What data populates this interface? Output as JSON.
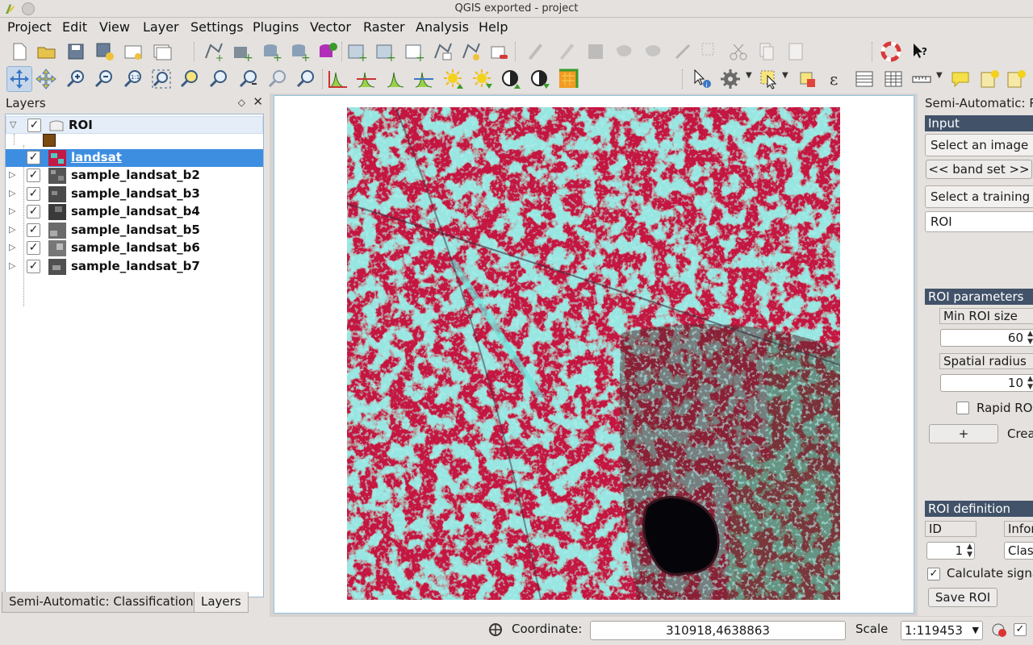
{
  "window": {
    "title": "QGIS exported - project"
  },
  "menu": [
    "Project",
    "Edit",
    "View",
    "Layer",
    "Settings",
    "Plugins",
    "Vector",
    "Raster",
    "Analysis",
    "Help"
  ],
  "layers_panel": {
    "title": "Layers",
    "float_icon": "◇",
    "close_icon": "✕",
    "group": {
      "name": "ROI",
      "checked": "✓",
      "expander": "▽"
    },
    "layers": [
      {
        "name": "landsat",
        "checked": "✓",
        "selected": true
      },
      {
        "name": "sample_landsat_b2",
        "checked": "✓",
        "expander": "▷"
      },
      {
        "name": "sample_landsat_b3",
        "checked": "✓",
        "expander": "▷"
      },
      {
        "name": "sample_landsat_b4",
        "checked": "✓",
        "expander": "▷"
      },
      {
        "name": "sample_landsat_b5",
        "checked": "✓",
        "expander": "▷"
      },
      {
        "name": "sample_landsat_b6",
        "checked": "✓",
        "expander": "▷"
      },
      {
        "name": "sample_landsat_b7",
        "checked": "✓",
        "expander": "▷"
      }
    ]
  },
  "bottom_tabs": [
    "Semi-Automatic: Classification",
    "Layers"
  ],
  "scp_dock": {
    "title": "Semi-Automatic: R",
    "input_header": "Input",
    "select_image": "Select an image",
    "band_set_button": "<< band set >>",
    "select_training": "Select a training s",
    "training_value": "ROI",
    "roi_params_header": "ROI parameters",
    "min_roi_size_label": "Min ROI size",
    "min_roi_size_value": "60",
    "spatial_radius_label": "Spatial radius",
    "spatial_radius_value": "10",
    "rapid_roi_label": "Rapid ROI",
    "plus_button": "+",
    "create_label": "Crea",
    "roi_def_header": "ROI definition",
    "id_label": "ID",
    "info_label": "Infor",
    "id_value": "1",
    "class_value": "Clas",
    "calc_sig_label": "Calculate signa",
    "calc_sig_checked": "✓",
    "save_roi_button": "Save ROI"
  },
  "statusbar": {
    "coordinate_label": "Coordinate:",
    "coordinate_value": "310918,4638863",
    "scale_label": "Scale",
    "scale_value": "1:119453"
  },
  "colors": {
    "accent_selected": "#3d8ee1",
    "section_header": "#415269",
    "vegetation": "#d21844",
    "urban": "#4fc9c2"
  }
}
